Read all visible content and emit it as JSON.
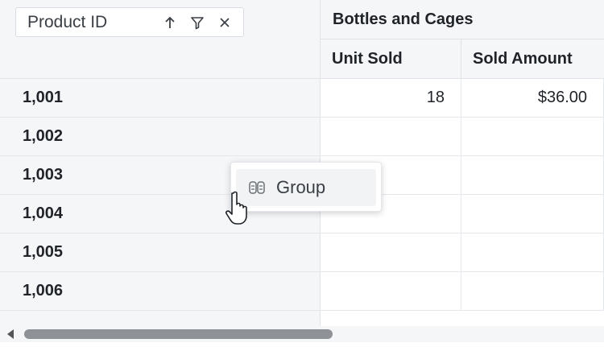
{
  "header": {
    "field_chip_label": "Product ID",
    "column_group": "Bottles and Cages",
    "columns": [
      "Unit Sold",
      "Sold Amount"
    ]
  },
  "rows": [
    {
      "id": "1,001",
      "unit_sold": "18",
      "sold_amount": "$36.00"
    },
    {
      "id": "1,002",
      "unit_sold": "",
      "sold_amount": ""
    },
    {
      "id": "1,003",
      "unit_sold": "",
      "sold_amount": ""
    },
    {
      "id": "1,004",
      "unit_sold": "",
      "sold_amount": ""
    },
    {
      "id": "1,005",
      "unit_sold": "",
      "sold_amount": ""
    },
    {
      "id": "1,006",
      "unit_sold": "",
      "sold_amount": ""
    }
  ],
  "context_menu": {
    "items": [
      {
        "label": "Group",
        "icon": "group-icon"
      }
    ]
  },
  "icons": {
    "sort": "sort-ascending-icon",
    "filter": "filter-icon",
    "remove": "close-icon"
  },
  "scrollbar": {
    "position": 0.0,
    "visible_fraction": 0.54
  }
}
